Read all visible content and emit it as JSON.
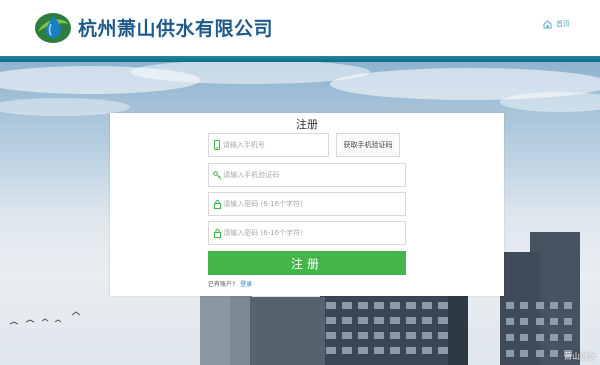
{
  "header": {
    "company_name": "杭州萧山供水有限公司",
    "home_label": "首页"
  },
  "register": {
    "title": "注册",
    "phone_placeholder": "请输入手机号",
    "get_code_label": "获取手机验证码",
    "code_placeholder": "请输入手机验证码",
    "password_placeholder": "请输入密码 (6-16个字符)",
    "confirm_password_placeholder": "请输入密码 (6-16个字符)",
    "submit_label": "注册",
    "has_account_text": "已有账户?",
    "login_link": "登录"
  },
  "watermark": "萧山供水",
  "colors": {
    "brand_blue": "#1f5a8c",
    "accent_teal": "#1f8aa0",
    "submit_green": "#44b549",
    "link_blue": "#2a7fd4"
  },
  "icons": {
    "logo": "water-drop-logo",
    "home": "home-icon",
    "phone": "phone-icon",
    "key": "key-icon",
    "lock": "lock-icon"
  }
}
